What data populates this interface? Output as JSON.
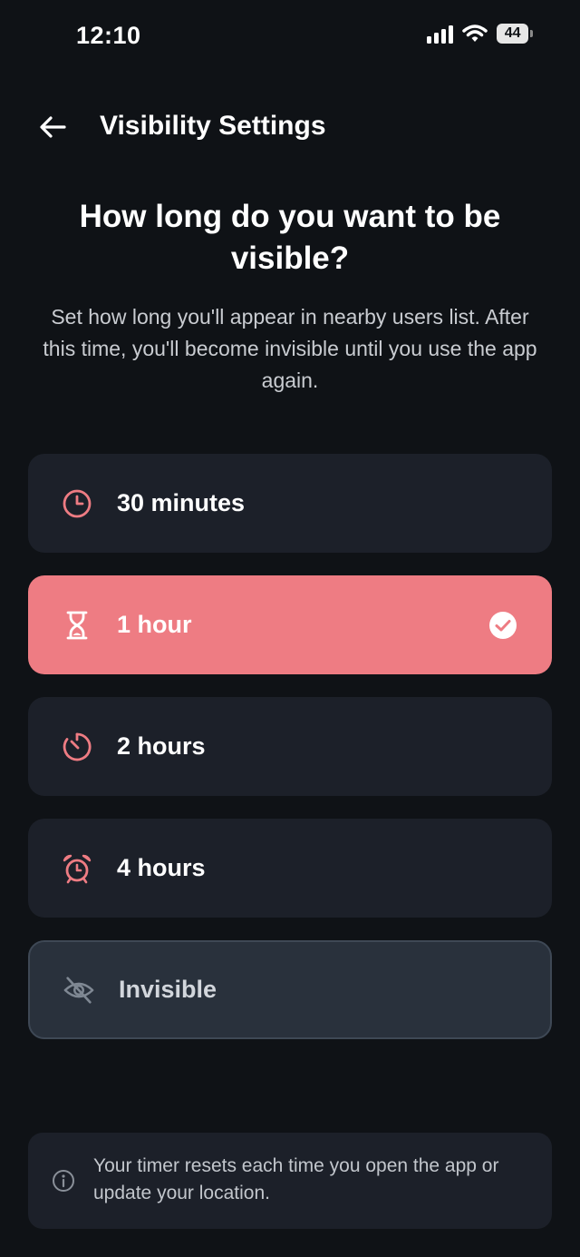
{
  "status_bar": {
    "time": "12:10",
    "battery": "44",
    "icons": [
      "signal-icon",
      "wifi-icon",
      "battery-icon"
    ]
  },
  "header": {
    "title": "Visibility Settings",
    "back_icon": "arrow-left-icon"
  },
  "intro": {
    "headline": "How long do you want to be visible?",
    "description": "Set how long you'll appear in nearby users list. After this time, you'll become invisible until you use the app again."
  },
  "options": [
    {
      "label": "30 minutes",
      "icon": "clock-icon",
      "selected": false
    },
    {
      "label": "1 hour",
      "icon": "hourglass-icon",
      "selected": true
    },
    {
      "label": "2 hours",
      "icon": "timer-icon",
      "selected": false
    },
    {
      "label": "4 hours",
      "icon": "alarm-clock-icon",
      "selected": false
    },
    {
      "label": "Invisible",
      "icon": "eye-off-icon",
      "selected": false
    }
  ],
  "info": {
    "icon": "info-icon",
    "text": "Your timer resets each time you open the app or update your location."
  },
  "colors": {
    "background": "#0f1216",
    "card": "#1c2029",
    "accent": "#ee7c83",
    "invisible_card": "#29313c"
  }
}
